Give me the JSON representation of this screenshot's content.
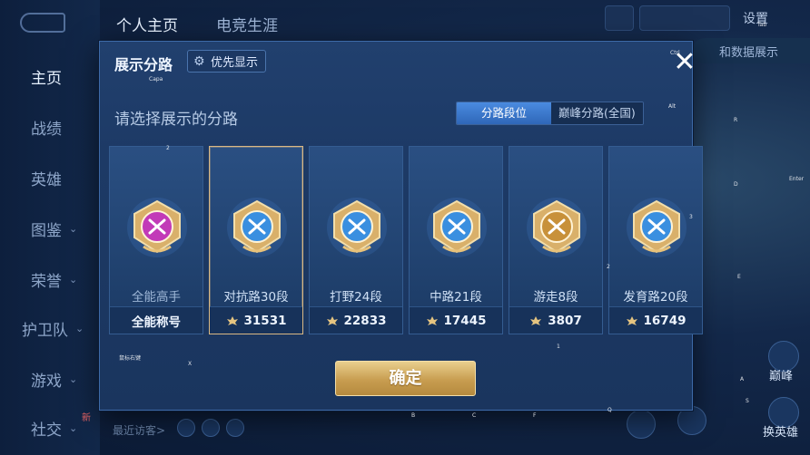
{
  "nav": {
    "items": [
      {
        "label": "主页",
        "chevron": false
      },
      {
        "label": "战绩",
        "chevron": false
      },
      {
        "label": "英雄",
        "chevron": false
      },
      {
        "label": "图鉴",
        "chevron": true
      },
      {
        "label": "荣誉",
        "chevron": true
      },
      {
        "label": "护卫队",
        "chevron": true
      },
      {
        "label": "游戏",
        "chevron": true
      },
      {
        "label": "社交",
        "chevron": true
      }
    ],
    "new_badge": "新"
  },
  "topbar": {
    "tab_profile": "个人主页",
    "tab_esports": "电竞生涯",
    "settings": "设置",
    "side_pill": "和数据展示"
  },
  "footer": {
    "recent_visitors": "最近访客>",
    "right_btn_1": "巅峰",
    "right_btn_2": "换英雄"
  },
  "dialog": {
    "title": "展示分路",
    "priority_button": "优先显示",
    "subtitle": "请选择展示的分路",
    "segments": [
      "分路段位",
      "巅峰分路(全国)"
    ],
    "confirm": "确定",
    "cards": [
      {
        "name": "全能高手",
        "footer": "全能称号",
        "points": null,
        "emblem": "allround-emblem",
        "color": "#c23ab8",
        "selected": false
      },
      {
        "name": "对抗路30段",
        "footer": null,
        "points": "31531",
        "emblem": "clash-lane-emblem",
        "color": "#3a8fe0",
        "selected": true
      },
      {
        "name": "打野24段",
        "footer": null,
        "points": "22833",
        "emblem": "jungle-emblem",
        "color": "#3a8fe0",
        "selected": false
      },
      {
        "name": "中路21段",
        "footer": null,
        "points": "17445",
        "emblem": "mid-lane-emblem",
        "color": "#3a8fe0",
        "selected": false
      },
      {
        "name": "游走8段",
        "footer": null,
        "points": "3807",
        "emblem": "roam-emblem",
        "color": "#c8913a",
        "selected": false
      },
      {
        "name": "发育路20段",
        "footer": null,
        "points": "16749",
        "emblem": "farm-lane-emblem",
        "color": "#3a8fe0",
        "selected": false
      }
    ]
  },
  "overlay_labels": [
    "Capa",
    "Ctrl",
    "2",
    "Z",
    "X",
    "O",
    "B",
    "C",
    "F",
    "Q",
    "A",
    "S",
    "E",
    "D",
    "R",
    "3",
    "1",
    "Tab",
    "Alt",
    "Enter",
    "鼠标右键"
  ],
  "colors": {
    "accent_gold": "#d9b884",
    "accent_blue": "#3a8fe0"
  }
}
